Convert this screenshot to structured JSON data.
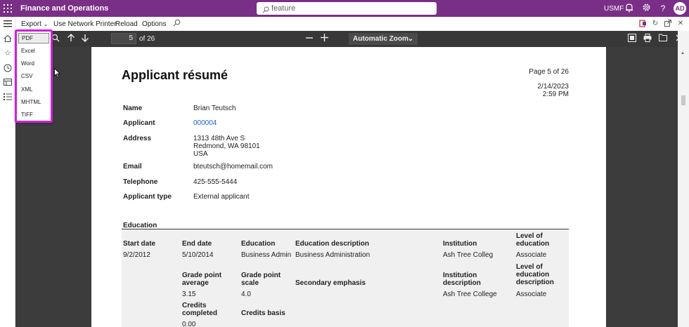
{
  "topbar": {
    "app_title": "Finance and Operations",
    "search_placeholder": "feature",
    "company": "USMF",
    "avatar_initials": "AD"
  },
  "actionbar": {
    "export_label": "Export",
    "network_printer_label": "Use Network Printer",
    "reload_label": "Reload",
    "options_label": "Options"
  },
  "export_menu": {
    "items": [
      "PDF",
      "Excel",
      "Word",
      "CSV",
      "XML",
      "MHTML",
      "TIFF"
    ],
    "selected": "PDF"
  },
  "pdf_toolbar": {
    "current_page": "5",
    "page_count_text": "of 26",
    "zoom": "Automatic Zoom"
  },
  "document": {
    "title": "Applicant résumé",
    "page_label": "Page 5 of 26",
    "date": "2/14/2023",
    "time": "2:59 PM",
    "fields": [
      {
        "label": "Name",
        "value": "Brian Teutsch"
      },
      {
        "label": "Applicant",
        "value": "000004"
      },
      {
        "label": "Address",
        "value_lines": [
          "1313 48th Ave S",
          "Redmond, WA 98101",
          "USA"
        ]
      },
      {
        "label": "Email",
        "value": "bteutsch@homemail.com"
      },
      {
        "label": "Telephone",
        "value": "425-555-5444"
      },
      {
        "label": "Applicant type",
        "value": "External applicant"
      }
    ],
    "education": {
      "section_title": "Education",
      "headers": {
        "start_date": "Start date",
        "end_date": "End date",
        "education": "Education",
        "education_description": "Education description",
        "institution": "Institution",
        "level_of_education": [
          "Level of",
          "education"
        ],
        "gpa": [
          "Grade point",
          "average"
        ],
        "grade_point_scale": [
          "Grade point",
          "scale"
        ],
        "secondary_emphasis": "Secondary emphasis",
        "institution_description": [
          "Institution",
          "description"
        ],
        "level_of_education_description": [
          "Level of",
          "education",
          "description"
        ],
        "credits_completed": [
          "Credits",
          "completed"
        ],
        "credits_basis": "Credits basis"
      },
      "row": {
        "start_date": "9/2/2012",
        "end_date": "5/10/2014",
        "education": "Business Admin",
        "education_description": "Business Administration",
        "institution": "Ash Tree Colleg",
        "level_of_education": "Associate",
        "gpa": "3.15",
        "grade_point_scale": "4.0",
        "institution_description": "Ash Tree College",
        "level_of_education_description": "Associate",
        "credits_completed": "0.00"
      }
    }
  },
  "colors": {
    "brand": "#7a2f86",
    "highlight": "#d020d8",
    "link": "#1a5fc4"
  }
}
